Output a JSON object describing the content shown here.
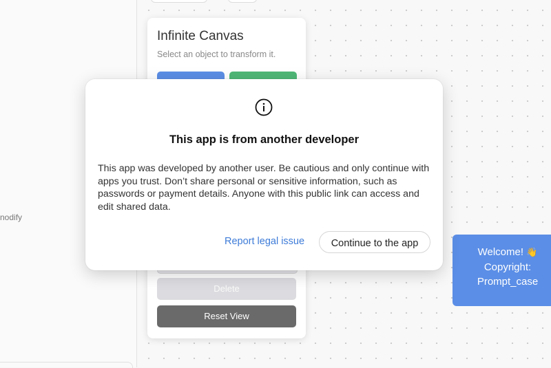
{
  "left_panel": {
    "partial_text": "nodify"
  },
  "card": {
    "title": "Infinite Canvas",
    "subtitle": "Select an object to transform it.",
    "delete_label": "Delete",
    "reset_label": "Reset View"
  },
  "welcome_card": {
    "line1": "Welcome!",
    "emoji": "👋",
    "line2": "Copyright:",
    "line3": "Prompt_case"
  },
  "modal": {
    "icon": "info-circle-icon",
    "title": "This app is from another developer",
    "body": "This app was developed by another user. Be cautious and only continue with apps you trust. Don’t share personal or sensitive information, such as passwords or payment details. Anyone with this public link can access and edit shared data.",
    "report_label": "Report legal issue",
    "continue_label": "Continue to the app"
  },
  "colors": {
    "accent_blue": "#5b8ee6",
    "accent_green": "#4fb877",
    "link_blue": "#3d7bd8",
    "reset_gray": "#6a6a6a"
  }
}
